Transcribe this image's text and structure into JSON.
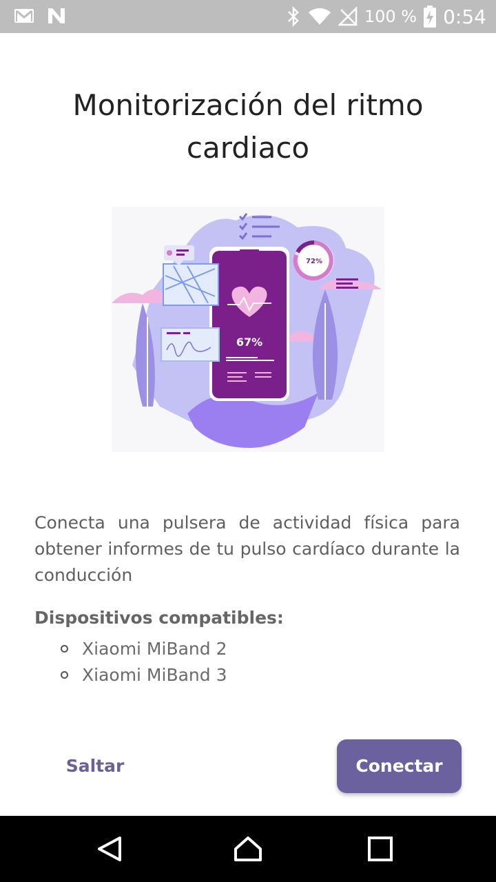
{
  "status_bar": {
    "battery_percent": "100 %",
    "time": "0:54",
    "icons": [
      "gmail-icon",
      "n-icon",
      "bluetooth-icon",
      "wifi-icon",
      "no-signal-icon",
      "battery-charging-icon"
    ]
  },
  "title": "Monitorización del ritmo cardiaco",
  "illustration": {
    "heart_rate_percent": "67%",
    "ring_percent": "72%",
    "colors": {
      "purple_dark": "#7b1f8a",
      "purple_mid": "#9b7ff0",
      "lavender": "#c4c2f5",
      "pink": "#f2b5e0"
    }
  },
  "description": "Conecta una pulsera de actividad física para obtener informes de tu pulso cardíaco durante la conducción",
  "compatible": {
    "title": "Dispositivos compatibles:",
    "devices": [
      "Xiaomi MiBand 2",
      "Xiaomi MiBand 3"
    ]
  },
  "actions": {
    "skip_label": "Saltar",
    "connect_label": "Conectar",
    "accent_color": "#6b619f"
  },
  "nav_bar": {
    "icons": [
      "back-icon",
      "home-icon",
      "recents-icon"
    ]
  }
}
